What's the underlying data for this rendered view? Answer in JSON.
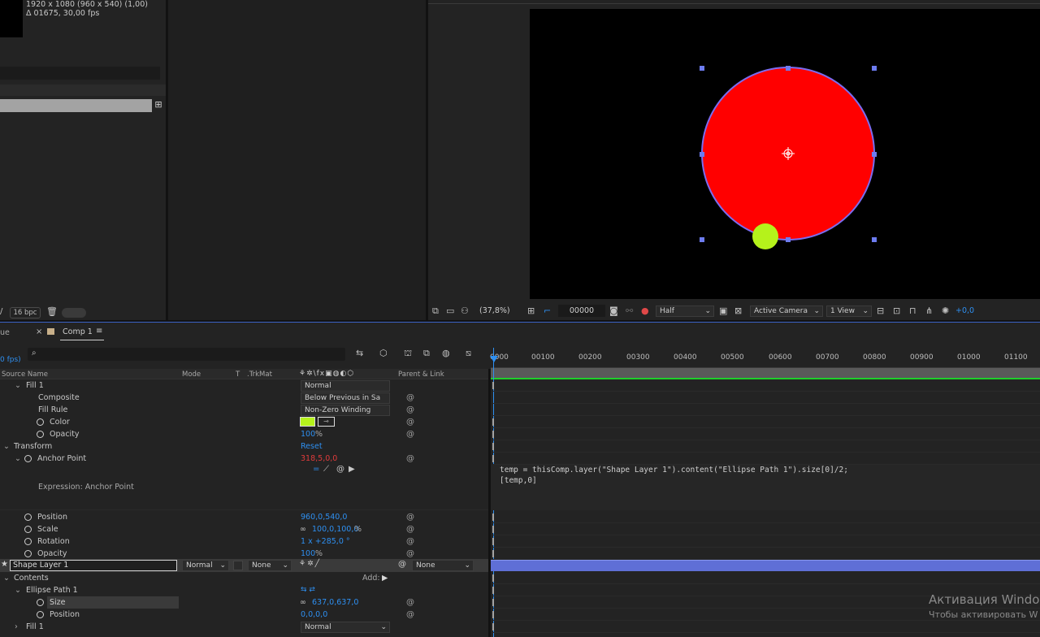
{
  "project": {
    "comp_info_line1": "1920 x 1080  (960 x 540) (1,00)",
    "comp_info_line2": "Δ 01675, 30,00 fps",
    "bpc": "16 bpc"
  },
  "viewer": {
    "zoom": "(37,8%)",
    "timecode": "00000",
    "resolution": "Half",
    "camera": "Active Camera",
    "views": "1 View",
    "exposure": "+0,0",
    "colors": {
      "circle": "#ff0000",
      "dot": "#b5f21b",
      "outline": "#7b6cf0"
    }
  },
  "timeline": {
    "left_tab_partial": "ue",
    "tab_close": "×",
    "tab_label": "Comp 1",
    "tab_menu": "≡",
    "fps_partial": "0 fps)",
    "search_icon": "⌕",
    "headers": {
      "source_name": "Source Name",
      "mode": "Mode",
      "t": "T",
      "trkmat": ".TrkMat",
      "parent": "Parent & Link"
    },
    "ruler": [
      "0000",
      "00100",
      "00200",
      "00300",
      "00400",
      "00500",
      "00600",
      "00700",
      "00800",
      "00900",
      "01000",
      "01100"
    ],
    "rows": {
      "fill1_top": "Fill 1",
      "fill1_top_mode": "Normal",
      "composite": "Composite",
      "composite_val": "Below Previous in Sa",
      "fill_rule": "Fill Rule",
      "fill_rule_val": "Non-Zero Winding",
      "color": "Color",
      "opacity1": "Opacity",
      "opacity1_val": "100",
      "pct": "%",
      "transform": "Transform",
      "transform_reset": "Reset",
      "anchor_point": "Anchor Point",
      "anchor_point_val": "318,5,0,0",
      "expression_label": "Expression: Anchor Point",
      "expression_line1": "temp = thisComp.layer(\"Shape Layer 1\").content(\"Ellipse Path 1\").size[0]/2;",
      "expression_line2": "[temp,0]",
      "position": "Position",
      "position_val": "960,0,540,0",
      "scale": "Scale",
      "scale_val": "100,0,100,0",
      "rotation": "Rotation",
      "rotation_val": "1 x +285,0 °",
      "opacity2": "Opacity",
      "opacity2_val": "100",
      "layer_name": "Shape Layer 1",
      "layer_mode": "Normal",
      "layer_trkmat": "None",
      "layer_parent": "None",
      "contents": "Contents",
      "add": "Add:",
      "ellipse_path": "Ellipse Path 1",
      "size": "Size",
      "size_val": "637,0,637,0",
      "position2": "Position",
      "position2_val": "0,0,0,0",
      "fill1_bottom": "Fill 1",
      "fill1_bottom_mode": "Normal"
    }
  },
  "watermark": {
    "line1": "Активация Windo",
    "line2": "Чтобы активировать W"
  }
}
